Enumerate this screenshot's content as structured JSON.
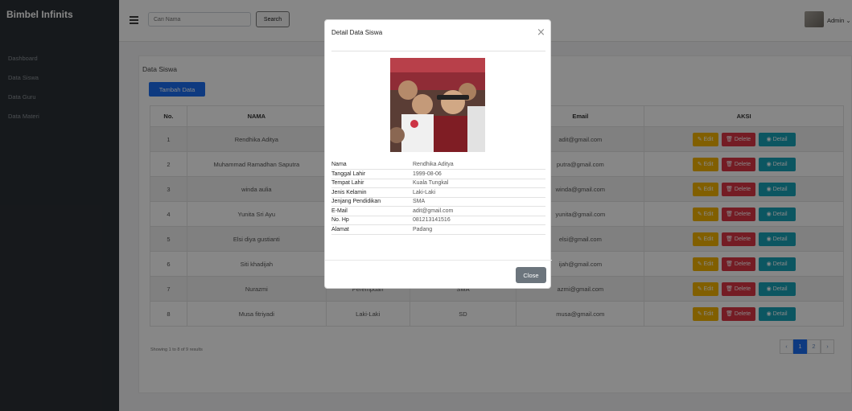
{
  "app": {
    "brand": "Bimbel Infinits"
  },
  "sidebar": {
    "items": [
      "Dashboard",
      "Data Siswa",
      "Data Guru",
      "Data Materi"
    ]
  },
  "topbar": {
    "search_placeholder": "Cari Nama",
    "search_label": "Search",
    "user": "Admin"
  },
  "card": {
    "title": "Data Siswa",
    "add_label": "Tambah Data"
  },
  "table": {
    "headers": [
      "No.",
      "NAMA",
      "",
      "",
      "Email",
      "AKSI"
    ],
    "rows": [
      {
        "no": "1",
        "nama": "Rendhika Aditya",
        "jk": "",
        "jenjang": "",
        "email": "adit@gmail.com"
      },
      {
        "no": "2",
        "nama": "Muhammad Ramadhan Saputra",
        "jk": "",
        "jenjang": "",
        "email": "putra@gmail.com"
      },
      {
        "no": "3",
        "nama": "winda aulia",
        "jk": "",
        "jenjang": "",
        "email": "winda@gmail.com"
      },
      {
        "no": "4",
        "nama": "Yunita Sri Ayu",
        "jk": "",
        "jenjang": "",
        "email": "yunita@gmail.com"
      },
      {
        "no": "5",
        "nama": "Elsi diya gustianti",
        "jk": "",
        "jenjang": "",
        "email": "elsi@gmail.com"
      },
      {
        "no": "6",
        "nama": "Siti khadijah",
        "jk": "",
        "jenjang": "",
        "email": "ijah@gmail.com"
      },
      {
        "no": "7",
        "nama": "Nurazmi",
        "jk": "Perempuan",
        "jenjang": "SMA",
        "email": "azmi@gmail.com"
      },
      {
        "no": "8",
        "nama": "Musa fitriyadi",
        "jk": "Laki-Laki",
        "jenjang": "SD",
        "email": "musa@gmail.com"
      }
    ],
    "actions": {
      "edit": "Edit",
      "delete": "Delete",
      "detail": "Detail"
    }
  },
  "pagination": {
    "showing": "Showing 1 to 8 of 9 results",
    "prev": "‹",
    "pages": [
      "1",
      "2"
    ],
    "next": "›",
    "current": "1"
  },
  "modal": {
    "title": "Detail Data Siswa",
    "close_icon": "×",
    "fields": [
      {
        "label": "Nama",
        "value": "Rendhika Aditya"
      },
      {
        "label": "Tanggal Lahir",
        "value": "1999-08-06"
      },
      {
        "label": "Tempat Lahir",
        "value": "Kuala Tungkal"
      },
      {
        "label": "Jenis Kelamin",
        "value": "Laki-Laki"
      },
      {
        "label": "Jenjang Pendidikan",
        "value": "SMA"
      },
      {
        "label": "E-Mail",
        "value": "adit@gmail.com"
      },
      {
        "label": "No. Hp",
        "value": "081213141516"
      },
      {
        "label": "Alamat",
        "value": "Padang"
      }
    ],
    "close_label": "Close"
  }
}
